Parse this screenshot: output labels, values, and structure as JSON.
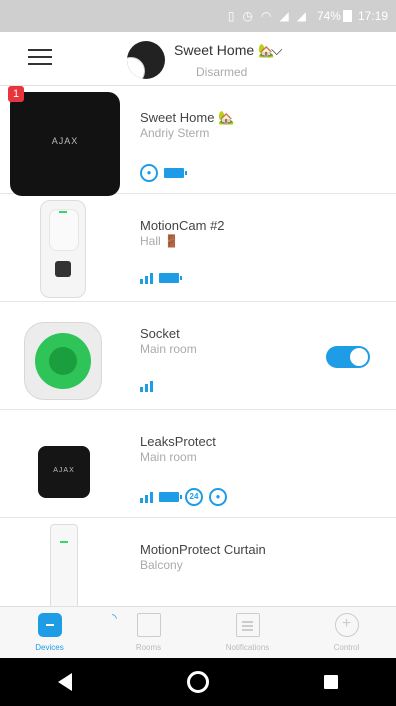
{
  "status_bar": {
    "battery": "74%",
    "time": "17:19"
  },
  "header": {
    "hub_name": "Sweet Home",
    "hub_emoji": "🏡",
    "status": "Disarmed"
  },
  "devices": [
    {
      "name": "Sweet Home",
      "emoji": "🏡",
      "room": "Andriy Sterm",
      "badge": "1",
      "logo": "AJAX"
    },
    {
      "name": "MotionCam #2",
      "room": "Hall",
      "room_emoji": "🚪"
    },
    {
      "name": "Socket",
      "room": "Main room",
      "toggle_on": true
    },
    {
      "name": "LeaksProtect",
      "room": "Main room",
      "logo": "AJAX",
      "circle_label": "24"
    },
    {
      "name": "MotionProtect Curtain",
      "room": "Balcony"
    }
  ],
  "tabs": [
    {
      "label": "Devices",
      "active": true
    },
    {
      "label": "Rooms"
    },
    {
      "label": "Notifications"
    },
    {
      "label": "Control"
    }
  ],
  "colors": {
    "accent": "#1e9de6",
    "badge": "#e8343d"
  }
}
